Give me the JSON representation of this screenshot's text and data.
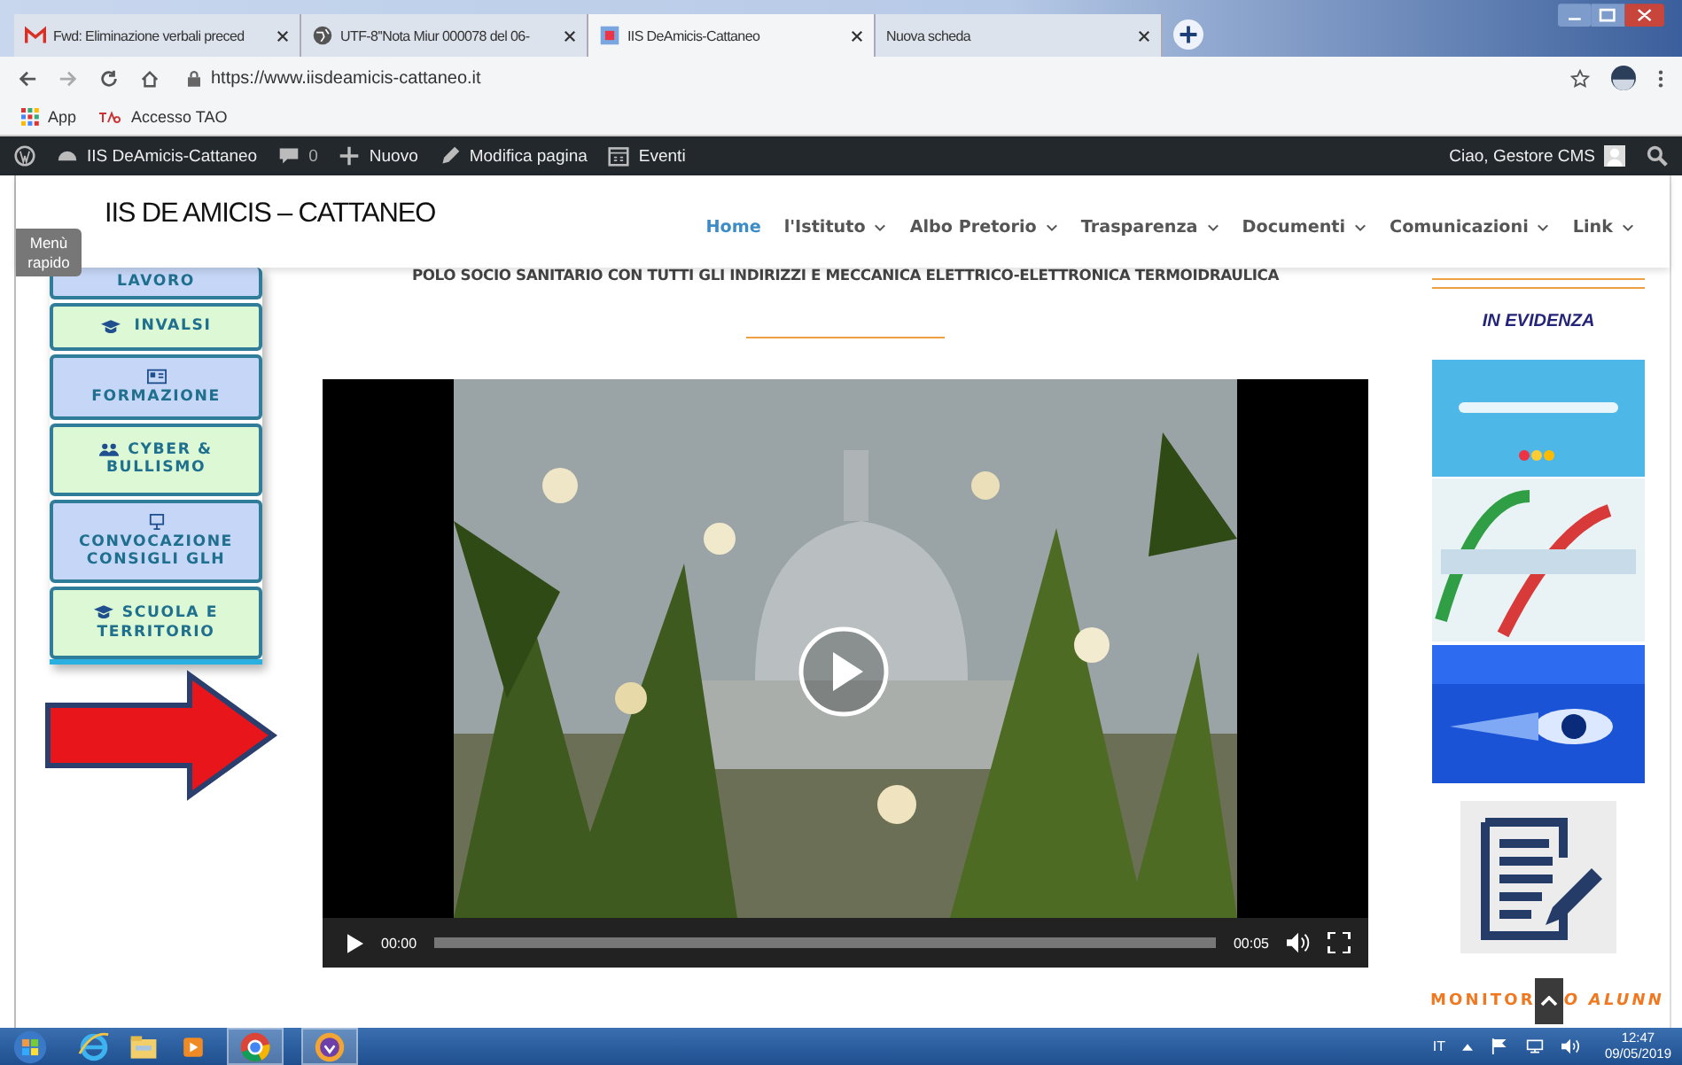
{
  "browser": {
    "tabs": [
      {
        "title": "Fwd: Eliminazione verbali preced",
        "selected": false
      },
      {
        "title": "UTF-8''Nota Miur 000078 del 06-",
        "selected": false
      },
      {
        "title": "IIS DeAmicis-Cattaneo",
        "selected": true
      },
      {
        "title": "Nuova scheda",
        "selected": false
      }
    ],
    "url": "https://www.iisdeamicis-cattaneo.it",
    "bookmarks": [
      "App",
      "Accesso TAO"
    ]
  },
  "admin_bar": {
    "site": "IIS DeAmicis-Cattaneo",
    "comments": "0",
    "new": "Nuovo",
    "edit": "Modifica pagina",
    "events": "Eventi",
    "greeting": "Ciao, Gestore CMS"
  },
  "site": {
    "logo": "IIS DE AMICIS – CATTANEO",
    "nav": [
      {
        "label": "Home",
        "selected": true,
        "has_menu": false
      },
      {
        "label": "l'Istituto",
        "selected": false,
        "has_menu": true
      },
      {
        "label": "Albo Pretorio",
        "selected": false,
        "has_menu": true
      },
      {
        "label": "Trasparenza",
        "selected": false,
        "has_menu": true
      },
      {
        "label": "Documenti",
        "selected": false,
        "has_menu": true
      },
      {
        "label": "Comunicazioni",
        "selected": false,
        "has_menu": true
      },
      {
        "label": "Link",
        "selected": false,
        "has_menu": true
      }
    ]
  },
  "tagline": "POLO SOCIO SANITARIO CON TUTTI GLI INDIRIZZI E MECCANICA ELETTRICO-ELETTRONICA TERMOIDRAULICA",
  "quick_menu": {
    "tab": "Menù rapido",
    "items": [
      {
        "label": "LAVORO",
        "color": "#c6d6f6"
      },
      {
        "label": "INVALSI",
        "color": "#dcf8d4"
      },
      {
        "label": "FORMAZIONE",
        "color": "#c6d6f6"
      },
      {
        "label": "CYBER & BULLISMO",
        "color": "#dcf8d4"
      },
      {
        "label": "CONVOCAZIONE CONSIGLI GLH",
        "color": "#c6d6f6"
      },
      {
        "label": "SCUOLA E TERRITORIO",
        "color": "#dcf8d4"
      }
    ]
  },
  "video": {
    "current": "00:00",
    "duration": "00:05",
    "level": 0
  },
  "sidebar": {
    "heading": "IN EVIDENZA",
    "monitor_left": "MONITOR",
    "monitor_right": "O ALUNN"
  },
  "taskbar": {
    "language": "IT",
    "time": "12:47",
    "date": "09/05/2019"
  }
}
